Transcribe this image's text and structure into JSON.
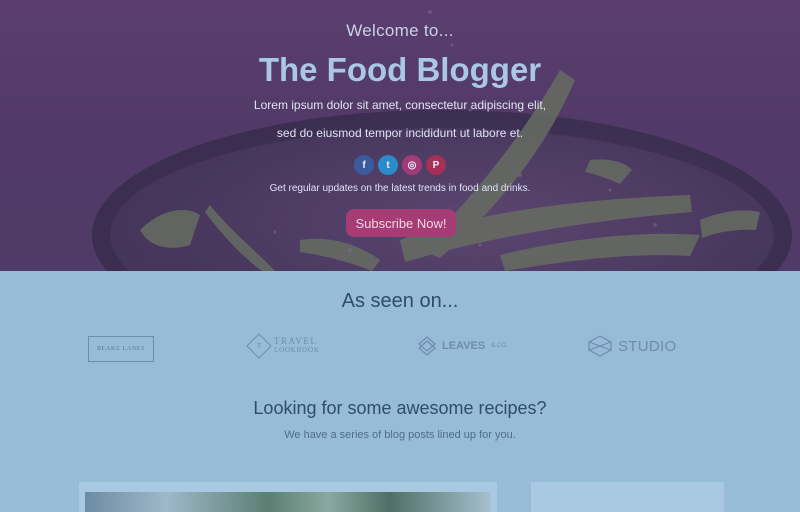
{
  "hero": {
    "welcome": "Welcome to...",
    "title": "The Food Blogger",
    "description_line1": "Lorem ipsum dolor sit amet, consectetur adipiscing elit,",
    "description_line2": "sed do eiusmod tempor incididunt ut labore et.",
    "socials": [
      {
        "name": "facebook",
        "glyph": "f",
        "color": "#3b5b9e"
      },
      {
        "name": "twitter",
        "glyph": "t",
        "color": "#2b8ac9"
      },
      {
        "name": "instagram",
        "glyph": "◎",
        "color": "#a33b79"
      },
      {
        "name": "pinterest",
        "glyph": "P",
        "color": "#a42f57"
      }
    ],
    "updates_text": "Get regular updates on the latest trends in food and drinks.",
    "subscribe_label": "Subscribe Now!"
  },
  "seen_on": {
    "title": "As seen on...",
    "logos": {
      "blake": "BLAKE LANES",
      "travel": "TRAVEL",
      "travel_sub": "LOOKBOOK",
      "travel_mark": "T",
      "leaves": "LEAVES",
      "leaves_sub": "& CO.",
      "studio": "STUDIO"
    }
  },
  "recipes": {
    "title": "Looking for some awesome recipes?",
    "subtitle": "We have a series of blog posts lined up for you."
  },
  "colors": {
    "hero_overlay": "#5a3e6c",
    "page_background": "#96bcd7",
    "title": "#aac8e6",
    "button": "#a63c74",
    "heading": "#2f4d6c"
  }
}
